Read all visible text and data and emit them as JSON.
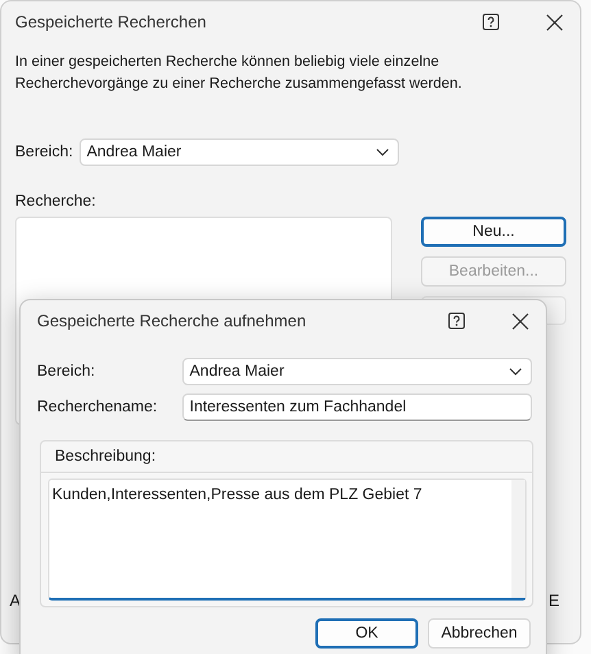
{
  "main_dialog": {
    "title": "Gespeicherte Recherchen",
    "intro": "In einer gespeicherten Recherche können beliebig viele einzelne Recherchevorgänge zu einer Recherche zusammengefasst werden.",
    "bereich_label": "Bereich:",
    "bereich_value": "Andrea Maier",
    "recherche_label": "Recherche:",
    "buttons": [
      {
        "label": "Neu...",
        "focused": true,
        "disabled": false
      },
      {
        "label": "Bearbeiten...",
        "focused": false,
        "disabled": true
      }
    ],
    "bottom_left_text": "A",
    "bottom_right_text": "E"
  },
  "add_dialog": {
    "title": "Gespeicherte Recherche aufnehmen",
    "bereich_label": "Bereich:",
    "bereich_value": "Andrea Maier",
    "name_label": "Recherchename:",
    "name_value": "Interessenten zum Fachhandel",
    "description_label": "Beschreibung:",
    "description_value": "Kunden,Interessenten,Presse aus dem PLZ Gebiet 7",
    "buttons": [
      {
        "label": "OK",
        "focused": true
      },
      {
        "label": "Abbrechen",
        "focused": false
      }
    ]
  }
}
